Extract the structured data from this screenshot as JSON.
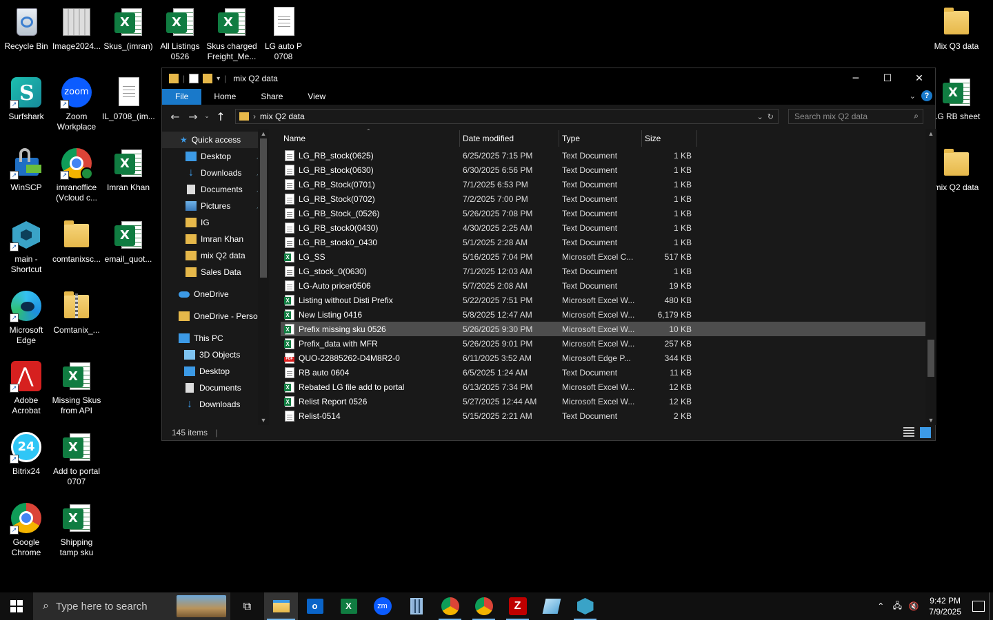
{
  "desktop": {
    "icons": [
      {
        "label": "Recycle Bin"
      },
      {
        "label": "Image2024..."
      },
      {
        "label": "Skus_(imran)"
      },
      {
        "label": "All Listings 0526"
      },
      {
        "label": "Skus charged Freight_Me..."
      },
      {
        "label": "LG auto P 0708"
      },
      {
        "label": "Mix Q3 data"
      },
      {
        "label": "Surfshark"
      },
      {
        "label": "Zoom Workplace"
      },
      {
        "label": "IL_0708_(im..."
      },
      {
        "label": "LG RB sheet"
      },
      {
        "label": "WinSCP"
      },
      {
        "label": "imranoffice (Vcloud c..."
      },
      {
        "label": "Imran Khan"
      },
      {
        "label": "mix Q2 data"
      },
      {
        "label": "main - Shortcut"
      },
      {
        "label": "comtanixsc..."
      },
      {
        "label": "email_quot..."
      },
      {
        "label": "Microsoft Edge"
      },
      {
        "label": "Comtanix_..."
      },
      {
        "label": "Adobe Acrobat"
      },
      {
        "label": "Missing Skus from API"
      },
      {
        "label": "Bitrix24"
      },
      {
        "label": "Add to portal 0707"
      },
      {
        "label": "Google Chrome"
      },
      {
        "label": "Shipping tamp sku"
      }
    ],
    "zoom_badge": "zoom",
    "bitrix_badge": "24"
  },
  "explorer": {
    "title": "mix Q2 data",
    "ribbon_tabs": [
      "File",
      "Home",
      "Share",
      "View"
    ],
    "help_label": "?",
    "address_path": "mix Q2 data",
    "search_placeholder": "Search mix Q2 data",
    "nav": [
      {
        "label": "Quick access"
      },
      {
        "label": "Desktop"
      },
      {
        "label": "Downloads"
      },
      {
        "label": "Documents"
      },
      {
        "label": "Pictures"
      },
      {
        "label": "IG"
      },
      {
        "label": "Imran Khan"
      },
      {
        "label": "mix Q2 data"
      },
      {
        "label": "Sales Data"
      },
      {
        "label": "OneDrive"
      },
      {
        "label": "OneDrive - Persor"
      },
      {
        "label": "This PC"
      },
      {
        "label": "3D Objects"
      },
      {
        "label": "Desktop"
      },
      {
        "label": "Documents"
      },
      {
        "label": "Downloads"
      }
    ],
    "columns": [
      "Name",
      "Date modified",
      "Type",
      "Size"
    ],
    "files": [
      {
        "name": "LG_RB_stock(0625)",
        "date": "6/25/2025 7:15 PM",
        "type": "Text Document",
        "size": "1 KB",
        "kind": "txt"
      },
      {
        "name": "LG_RB_stock(0630)",
        "date": "6/30/2025 6:56 PM",
        "type": "Text Document",
        "size": "1 KB",
        "kind": "txt"
      },
      {
        "name": "LG_RB_Stock(0701)",
        "date": "7/1/2025 6:53 PM",
        "type": "Text Document",
        "size": "1 KB",
        "kind": "txt"
      },
      {
        "name": "LG_RB_Stock(0702)",
        "date": "7/2/2025 7:00 PM",
        "type": "Text Document",
        "size": "1 KB",
        "kind": "txt"
      },
      {
        "name": "LG_RB_Stock_(0526)",
        "date": "5/26/2025 7:08 PM",
        "type": "Text Document",
        "size": "1 KB",
        "kind": "txt"
      },
      {
        "name": "LG_RB_stock0(0430)",
        "date": "4/30/2025 2:25 AM",
        "type": "Text Document",
        "size": "1 KB",
        "kind": "txt"
      },
      {
        "name": "LG_RB_stock0_0430",
        "date": "5/1/2025 2:28 AM",
        "type": "Text Document",
        "size": "1 KB",
        "kind": "txt"
      },
      {
        "name": "LG_SS",
        "date": "5/16/2025 7:04 PM",
        "type": "Microsoft Excel C...",
        "size": "517 KB",
        "kind": "xls"
      },
      {
        "name": "LG_stock_0(0630)",
        "date": "7/1/2025 12:03 AM",
        "type": "Text Document",
        "size": "1 KB",
        "kind": "txt"
      },
      {
        "name": "LG-Auto pricer0506",
        "date": "5/7/2025 2:08 AM",
        "type": "Text Document",
        "size": "19 KB",
        "kind": "txt"
      },
      {
        "name": "Listing without Disti Prefix",
        "date": "5/22/2025 7:51 PM",
        "type": "Microsoft Excel W...",
        "size": "480 KB",
        "kind": "xls"
      },
      {
        "name": "New Listing 0416",
        "date": "5/8/2025 12:47 AM",
        "type": "Microsoft Excel W...",
        "size": "6,179 KB",
        "kind": "xls"
      },
      {
        "name": "Prefix missing sku 0526",
        "date": "5/26/2025 9:30 PM",
        "type": "Microsoft Excel W...",
        "size": "10 KB",
        "kind": "xls",
        "selected": true
      },
      {
        "name": "Prefix_data with MFR",
        "date": "5/26/2025 9:01 PM",
        "type": "Microsoft Excel W...",
        "size": "257 KB",
        "kind": "xls"
      },
      {
        "name": "QUO-22885262-D4M8R2-0",
        "date": "6/11/2025 3:52 AM",
        "type": "Microsoft Edge P...",
        "size": "344 KB",
        "kind": "pdf"
      },
      {
        "name": "RB auto 0604",
        "date": "6/5/2025 1:24 AM",
        "type": "Text Document",
        "size": "11 KB",
        "kind": "txt"
      },
      {
        "name": "Rebated LG file  add to portal",
        "date": "6/13/2025 7:34 PM",
        "type": "Microsoft Excel W...",
        "size": "12 KB",
        "kind": "xls"
      },
      {
        "name": "Relist Report 0526",
        "date": "5/27/2025 12:44 AM",
        "type": "Microsoft Excel W...",
        "size": "12 KB",
        "kind": "xls"
      },
      {
        "name": "Relist-0514",
        "date": "5/15/2025 2:21 AM",
        "type": "Text Document",
        "size": "2 KB",
        "kind": "txt"
      }
    ],
    "status_count": "145 items"
  },
  "taskbar": {
    "search_placeholder": "Type here to search",
    "time": "9:42 PM",
    "date": "7/9/2025"
  },
  "colors": {
    "accent": "#1979ca",
    "excel": "#107c41",
    "selection": "#4d4d4d"
  }
}
